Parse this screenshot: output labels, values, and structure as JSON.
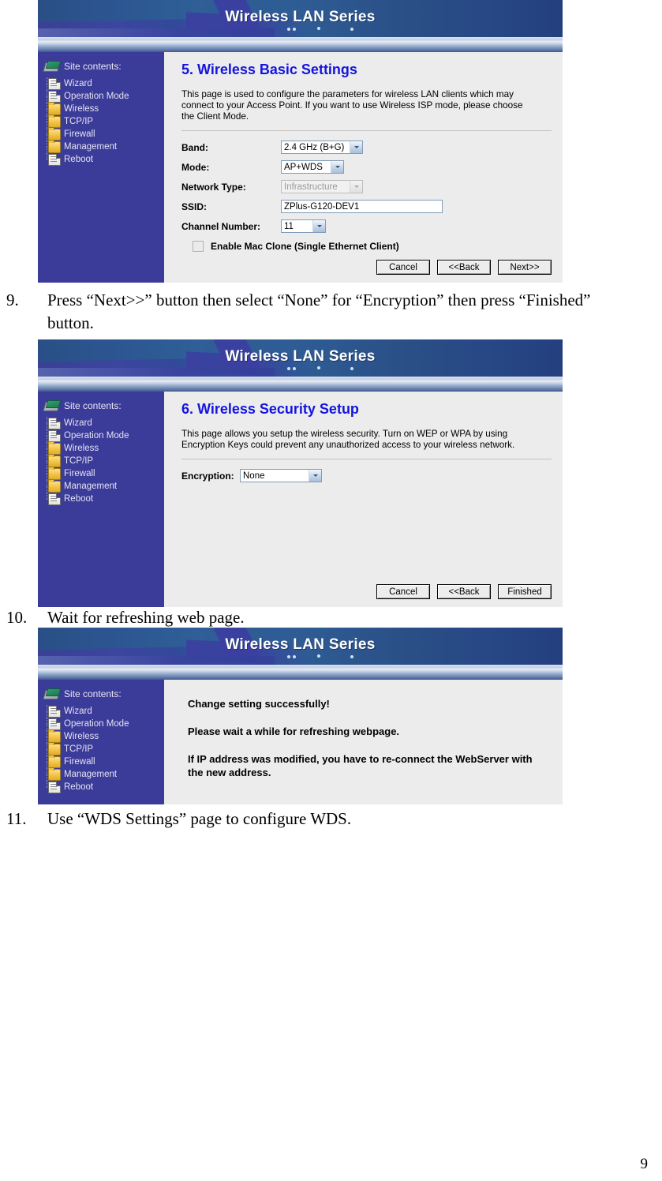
{
  "page_number": "9",
  "banner": {
    "title": "Wireless LAN Series"
  },
  "sidebar": {
    "heading": "Site contents:",
    "items": [
      {
        "label": "Wizard",
        "icon": "page-icon"
      },
      {
        "label": "Operation Mode",
        "icon": "page-icon"
      },
      {
        "label": "Wireless",
        "icon": "folder-icon"
      },
      {
        "label": "TCP/IP",
        "icon": "folder-icon"
      },
      {
        "label": "Firewall",
        "icon": "folder-icon"
      },
      {
        "label": "Management",
        "icon": "folder-icon"
      },
      {
        "label": "Reboot",
        "icon": "page-icon"
      }
    ]
  },
  "screenshot1": {
    "title": "5. Wireless Basic Settings",
    "description": "This page is used to configure the parameters for wireless LAN clients which may connect to your Access Point. If you want to use Wireless ISP mode, please choose the Client Mode.",
    "fields": {
      "band": {
        "label": "Band:",
        "value": "2.4 GHz (B+G)"
      },
      "mode": {
        "label": "Mode:",
        "value": "AP+WDS"
      },
      "network_type": {
        "label": "Network Type:",
        "value": "Infrastructure"
      },
      "ssid": {
        "label": "SSID:",
        "value": "ZPlus-G120-DEV1"
      },
      "channel_number": {
        "label": "Channel Number:",
        "value": "11"
      }
    },
    "mac_clone_label": "Enable Mac Clone (Single Ethernet Client)",
    "buttons": {
      "cancel": "Cancel",
      "back": "<<Back",
      "next": "Next>>"
    }
  },
  "screenshot2": {
    "title": "6. Wireless Security Setup",
    "description": "This page allows you setup the wireless security. Turn on WEP or WPA by using Encryption Keys could prevent any unauthorized access to your wireless network.",
    "fields": {
      "encryption": {
        "label": "Encryption:",
        "value": "None"
      }
    },
    "buttons": {
      "cancel": "Cancel",
      "back": "<<Back",
      "finished": "Finished"
    }
  },
  "screenshot3": {
    "messages": [
      "Change setting successfully!",
      "Please wait a while for refreshing webpage.",
      "If IP address was modified, you have to re-connect the WebServer with the new address."
    ]
  },
  "steps": [
    {
      "number": "9.",
      "text": "Press “Next>>” button then select “None” for “Encryption” then press “Finished” button."
    },
    {
      "number": "10.",
      "text": "Wait for refreshing web page."
    },
    {
      "number": "11.",
      "text": "Use “WDS Settings” page to configure WDS."
    }
  ],
  "colors": {
    "banner_blue": "#2f5f96",
    "sidebar_blue": "#3b3b99",
    "content_gray": "#ececec",
    "title_blue": "#1414e0"
  }
}
